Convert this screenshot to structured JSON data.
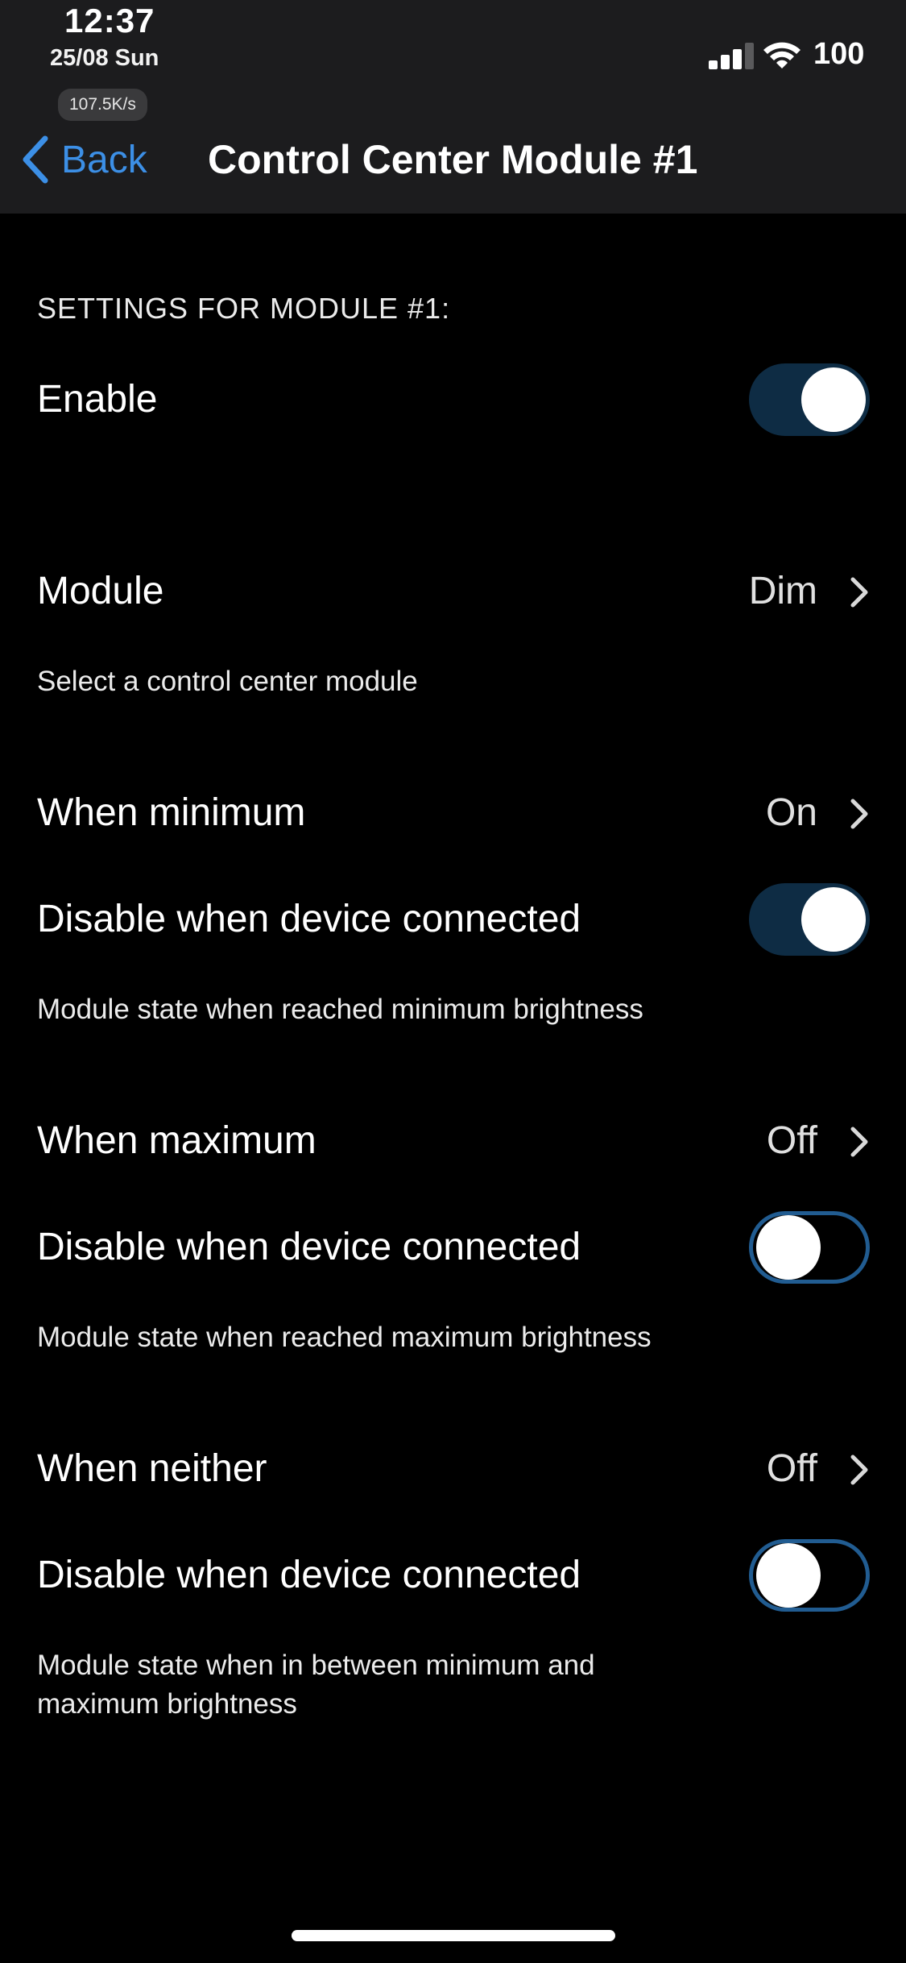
{
  "status_bar": {
    "time": "12:37",
    "date": "25/08 Sun",
    "network_speed": "107.5K/s",
    "battery": "100",
    "signal_icon": "cellular-signal-icon",
    "wifi_icon": "wifi-icon"
  },
  "nav": {
    "back_label": "Back",
    "title": "Control Center Module #1",
    "accent_color": "#3c8fe6"
  },
  "section": {
    "header": "SETTINGS FOR MODULE #1:",
    "enable": {
      "label": "Enable",
      "on": true
    }
  },
  "module": {
    "label": "Module",
    "value": "Dim",
    "footer": "Select a control center module"
  },
  "minimum": {
    "label": "When minimum",
    "value": "On",
    "disable_label": "Disable when device connected",
    "disable_on": true,
    "footer": "Module state when reached minimum brightness"
  },
  "maximum": {
    "label": "When maximum",
    "value": "Off",
    "disable_label": "Disable when device connected",
    "disable_on": false,
    "footer": "Module state when reached maximum brightness"
  },
  "neither": {
    "label": "When neither",
    "value": "Off",
    "disable_label": "Disable when device connected",
    "disable_on": false,
    "footer_line1": "Module state when in between minimum and",
    "footer_line2": "maximum brightness"
  },
  "colors": {
    "toggle_on_track": "#0e2c44",
    "toggle_off_border": "#215c91",
    "background": "#000000",
    "nav_background": "#1c1c1e"
  }
}
